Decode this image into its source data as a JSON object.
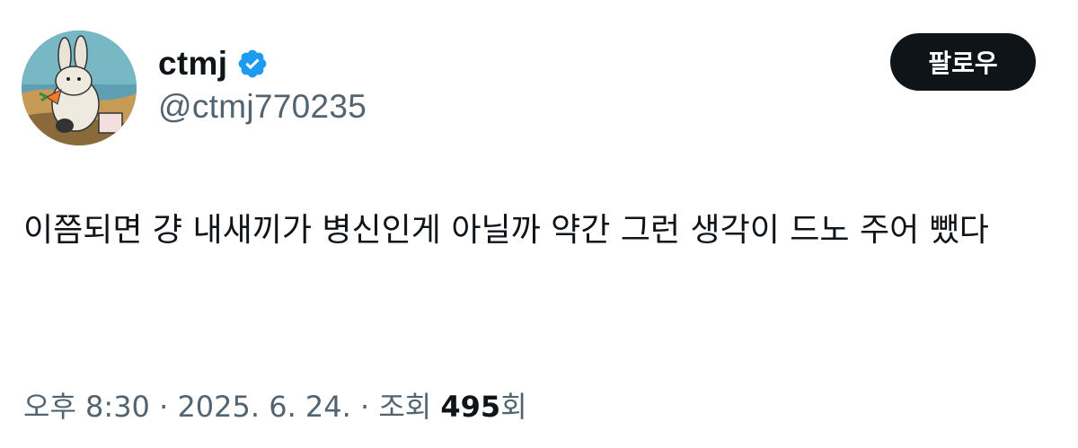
{
  "author": {
    "display_name": "ctmj",
    "handle": "@ctmj770235",
    "verified": true,
    "avatar_icon": "cartoon-rabbit-avatar"
  },
  "follow_button": {
    "label": "팔로우"
  },
  "tweet": {
    "text": "이쯤되면 걍 내새끼가 병신인게 아닐까 약간 그런 생각이 드노 주어 뺐다"
  },
  "meta": {
    "time": "오후 8:30",
    "separator": " · ",
    "date": "2025. 6. 24.",
    "views_label": "조회",
    "views_count": "495",
    "views_suffix": "회"
  },
  "colors": {
    "text_primary": "#0f1419",
    "text_secondary": "#536471",
    "verified_blue": "#1d9bf0",
    "button_bg": "#0f1419"
  }
}
